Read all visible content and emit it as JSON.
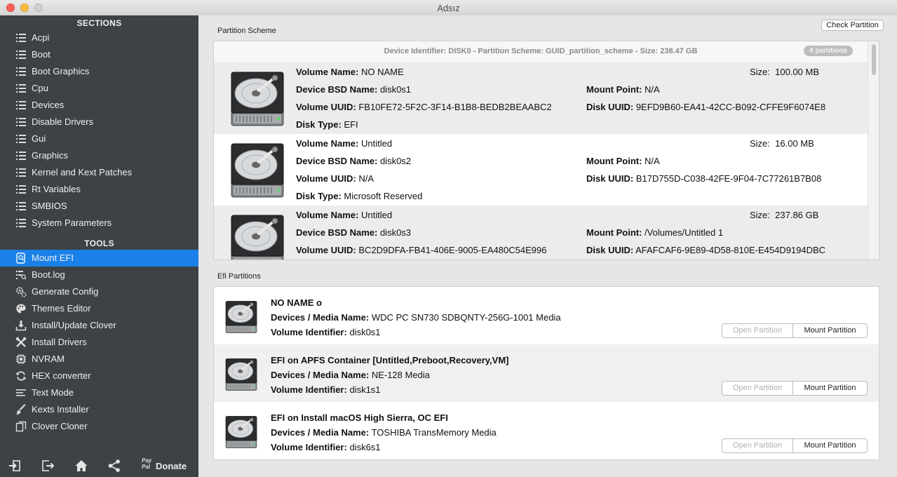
{
  "window": {
    "title": "Adsız"
  },
  "sidebar": {
    "sections_heading": "SECTIONS",
    "sections": [
      {
        "label": "Acpi"
      },
      {
        "label": "Boot"
      },
      {
        "label": "Boot Graphics"
      },
      {
        "label": "Cpu"
      },
      {
        "label": "Devices"
      },
      {
        "label": "Disable Drivers"
      },
      {
        "label": "Gui"
      },
      {
        "label": "Graphics"
      },
      {
        "label": "Kernel and Kext Patches"
      },
      {
        "label": "Rt Variables"
      },
      {
        "label": "SMBIOS"
      },
      {
        "label": "System Parameters"
      }
    ],
    "tools_heading": "TOOLS",
    "tools": [
      {
        "label": "Mount EFI",
        "icon": "disk-search-icon"
      },
      {
        "label": "Boot.log",
        "icon": "log-search-icon"
      },
      {
        "label": "Generate Config",
        "icon": "gears-icon"
      },
      {
        "label": "Themes Editor",
        "icon": "palette-icon"
      },
      {
        "label": "Install/Update Clover",
        "icon": "download-icon"
      },
      {
        "label": "Install Drivers",
        "icon": "tools-icon"
      },
      {
        "label": "NVRAM",
        "icon": "chip-icon"
      },
      {
        "label": "HEX converter",
        "icon": "refresh-icon"
      },
      {
        "label": "Text Mode",
        "icon": "text-lines-icon"
      },
      {
        "label": "Kexts Installer",
        "icon": "brush-icon"
      },
      {
        "label": "Clover Cloner",
        "icon": "copy-icon"
      }
    ],
    "footer": {
      "paypal_line1": "Pay",
      "paypal_line2": "Pal",
      "donate_label": "Donate"
    }
  },
  "toolbar": {
    "check_partition_label": "Check Partition"
  },
  "partition_scheme": {
    "group_label": "Partition Scheme",
    "header": "Device Identifier: DISK0 - Partition Scheme: GUID_partition_scheme - Size: 238.47 GB",
    "badge": "4 partitions",
    "labels": {
      "volume_name": "Volume Name:",
      "size": "Size:",
      "bsd": "Device BSD Name:",
      "mount": "Mount Point:",
      "vuuid": "Volume UUID:",
      "duuid": "Disk UUID:",
      "type": "Disk Type:"
    },
    "partitions": [
      {
        "volume_name": "NO NAME",
        "size": "100.00 MB",
        "bsd": "disk0s1",
        "mount": "N/A",
        "vuuid": "FB10FE72-5F2C-3F14-B1B8-BEDB2BEAABC2",
        "duuid": "9EFD9B60-EA41-42CC-B092-CFFE9F6074E8",
        "type": "EFI"
      },
      {
        "volume_name": "Untitled",
        "size": "16.00 MB",
        "bsd": "disk0s2",
        "mount": "N/A",
        "vuuid": "N/A",
        "duuid": "B17D755D-C038-42FE-9F04-7C77261B7B08",
        "type": "Microsoft Reserved"
      },
      {
        "volume_name": "Untitled",
        "size": "237.86 GB",
        "bsd": "disk0s3",
        "mount": "/Volumes/Untitled 1",
        "vuuid": "BC2D9DFA-FB41-406E-9005-EA480C54E996",
        "duuid": "AFAFCAF6-9E89-4D58-810E-E454D9194DBC",
        "type": ""
      }
    ]
  },
  "efi": {
    "group_label": "Efi Partitions",
    "labels": {
      "media": "Devices / Media Name:",
      "vol_id": "Volume Identifier:"
    },
    "open_label": "Open Partition",
    "mount_label": "Mount Partition",
    "items": [
      {
        "title": "NO NAME o",
        "media": "WDC PC SN730 SDBQNTY-256G-1001 Media",
        "vol_id": "disk0s1"
      },
      {
        "title": "EFI on APFS Container [Untitled,Preboot,Recovery,VM]",
        "media": "NE-128 Media",
        "vol_id": "disk1s1"
      },
      {
        "title": "EFI on Install macOS High Sierra, OC EFI",
        "media": "TOSHIBA TransMemory Media",
        "vol_id": "disk6s1"
      }
    ]
  },
  "colors": {
    "sidebar_bg": "#3d4245",
    "selection": "#1a81e8",
    "content_bg": "#e6e6e6"
  }
}
